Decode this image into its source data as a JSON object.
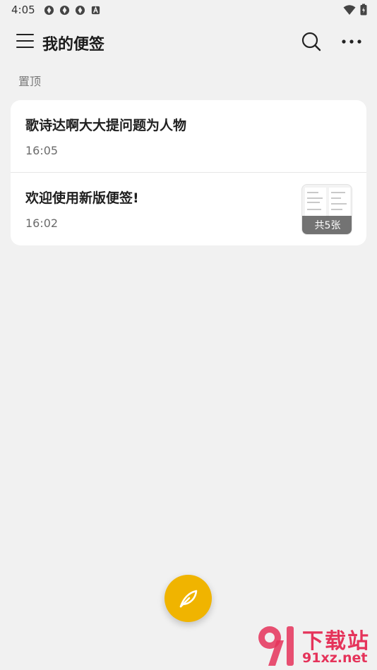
{
  "status_bar": {
    "time": "4:05",
    "icons": [
      "notification-icon",
      "notification-icon",
      "notification-icon",
      "keyboard-a-icon"
    ],
    "right_icons": [
      "wifi-icon",
      "battery-charging-icon"
    ]
  },
  "app_bar": {
    "title": "我的便签",
    "menu_icon": "hamburger-menu-icon",
    "search_icon": "search-icon",
    "more_icon": "more-dots-icon"
  },
  "section": {
    "label": "置顶"
  },
  "notes": [
    {
      "title": "歌诗达啊大大提问题为人物",
      "time": "16:05"
    },
    {
      "title": "欢迎使用新版便签!",
      "time": "16:02",
      "thumbnail_badge": "共5张"
    }
  ],
  "fab": {
    "icon": "feather-pen-icon",
    "color": "#f0b400"
  },
  "watermark": {
    "top_text": "下载站",
    "bottom_text": "91xz.net",
    "color": "#e5335a"
  }
}
